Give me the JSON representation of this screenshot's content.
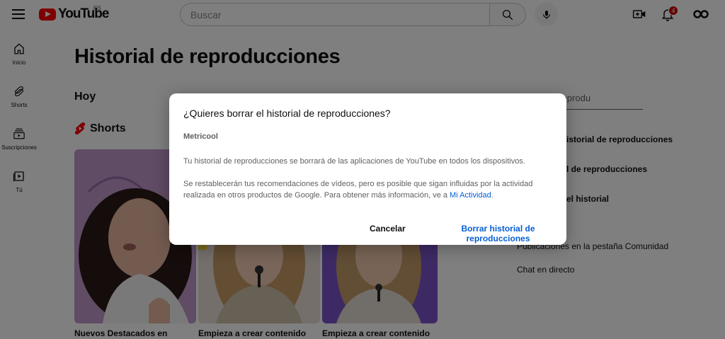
{
  "header": {
    "logo_text": "YouTube",
    "country_code": "ES",
    "search_placeholder": "Buscar",
    "notification_count": "4"
  },
  "sidenav": {
    "items": [
      {
        "label": "Inicio",
        "icon": "home-icon"
      },
      {
        "label": "Shorts",
        "icon": "shorts-icon"
      },
      {
        "label": "Suscripciones",
        "icon": "subscriptions-icon"
      },
      {
        "label": "Tú",
        "icon": "you-icon"
      }
    ]
  },
  "main": {
    "page_title": "Historial de reproducciones",
    "day_title": "Hoy",
    "shorts_label": "Shorts",
    "thumbnails": [
      {
        "caption": "Nuevos Destacados en"
      },
      {
        "caption": "Empieza a crear contenido"
      },
      {
        "caption": "Empieza a crear contenido"
      }
    ]
  },
  "right_panel": {
    "search_text": "istorial de reprodu",
    "items": [
      "istorial de reproducciones",
      "l de reproducciones",
      "el historial",
      "Publicaciones en la pestaña Comunidad",
      "Chat en directo"
    ]
  },
  "dialog": {
    "title": "¿Quieres borrar el historial de reproducciones?",
    "account": "Metricool",
    "paragraph1": "Tu historial de reproducciones se borrará de las aplicaciones de YouTube en todos los dispositivos.",
    "paragraph2": "Se restablecerán tus recomendaciones de vídeos, pero es posible que sigan influidas por la actividad realizada en otros productos de Google. Para obtener más información, ve a ",
    "link_text": "Mi Actividad",
    "paragraph2_end": ".",
    "cancel_label": "Cancelar",
    "confirm_label": "Borrar historial de reproducciones"
  },
  "colors": {
    "brand_red": "#ff0000",
    "link_blue": "#065fd4",
    "badge_red": "#cc0000"
  }
}
